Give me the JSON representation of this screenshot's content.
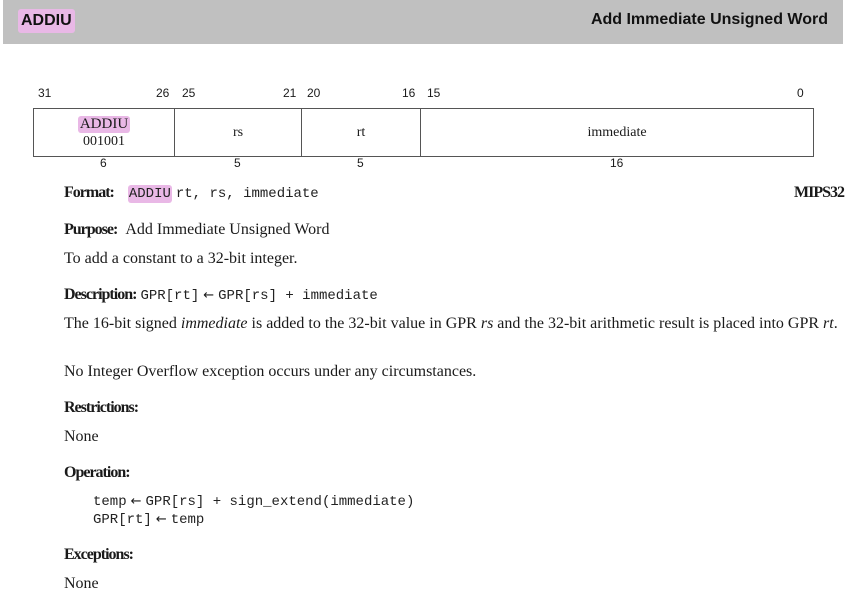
{
  "header": {
    "mnemonic": "ADDIU",
    "title": "Add Immediate Unsigned Word"
  },
  "encoding": {
    "bit_numbers": [
      "31",
      "26",
      "25",
      "21",
      "20",
      "16",
      "15",
      "0"
    ],
    "fields": [
      {
        "name": "ADDIU",
        "value": "001001",
        "width": "6"
      },
      {
        "name": "rs",
        "width": "5"
      },
      {
        "name": "rt",
        "width": "5"
      },
      {
        "name": "immediate",
        "width": "16"
      }
    ]
  },
  "format": {
    "label": "Format:",
    "op": "ADDIU",
    "operands": "rt, rs, immediate",
    "isa": "MIPS32"
  },
  "purpose": {
    "label": "Purpose:",
    "text": "Add Immediate Unsigned Word",
    "detail": "To add a constant to a 32-bit integer."
  },
  "description": {
    "label": "Description:",
    "code_lhs": "GPR[rt]",
    "arrow": "←",
    "code_rhs": "GPR[rs] + immediate",
    "p1_a": "The 16-bit signed ",
    "p1_imm": "immediate",
    "p1_b": " is added to the 32-bit value in GPR ",
    "p1_rs": "rs",
    "p1_c": " and the 32-bit arithmetic result is placed into GPR ",
    "p1_rt": "rt",
    "p1_d": ".",
    "p2": "No Integer Overflow exception occurs under any circumstances."
  },
  "restrictions": {
    "label": "Restrictions:",
    "text": "None"
  },
  "operation": {
    "label": "Operation:",
    "line1_lhs": "temp",
    "line1_rhs": "GPR[rs] + sign_extend(immediate)",
    "line2_lhs": "GPR[rt]",
    "line2_rhs": "temp",
    "arrow": "←"
  },
  "exceptions": {
    "label": "Exceptions:",
    "text": "None"
  }
}
